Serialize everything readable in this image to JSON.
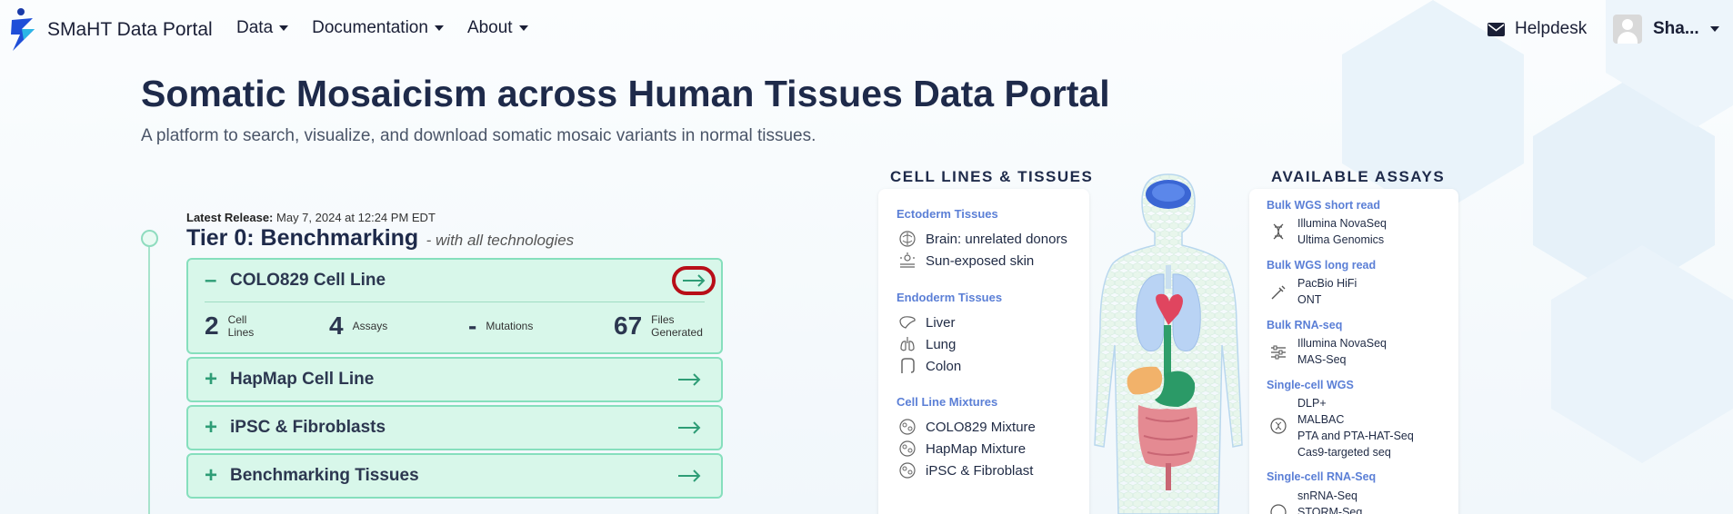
{
  "nav": {
    "brand": "SMaHT Data Portal",
    "menu": [
      {
        "label": "Data"
      },
      {
        "label": "Documentation"
      },
      {
        "label": "About"
      }
    ],
    "helpdesk": "Helpdesk",
    "user": "Sha..."
  },
  "hero": {
    "title": "Somatic Mosaicism across Human Tissues Data Portal",
    "subtitle": "A platform to search, visualize, and download somatic mosaic variants in normal tissues."
  },
  "release": {
    "label": "Latest Release:",
    "date": "May 7, 2024 at 12:24 PM EDT"
  },
  "tier": {
    "title": "Tier 0: Benchmarking",
    "subtitle": "- with all technologies"
  },
  "cards": [
    {
      "title": "COLO829 Cell Line",
      "sign": "–",
      "expanded": true,
      "stats": [
        {
          "num": "2",
          "label": "Cell Lines"
        },
        {
          "num": "4",
          "label": "Assays"
        },
        {
          "num": "-",
          "label": "Mutations"
        },
        {
          "num": "67",
          "label": "Files Generated"
        }
      ]
    },
    {
      "title": "HapMap Cell Line",
      "sign": "+"
    },
    {
      "title": "iPSC & Fibroblasts",
      "sign": "+"
    },
    {
      "title": "Benchmarking Tissues",
      "sign": "+"
    }
  ],
  "cell_lines_tissues": {
    "title": "CELL LINES & TISSUES",
    "groups": [
      {
        "title": "Ectoderm Tissues",
        "items": [
          {
            "label": "Brain: unrelated donors",
            "icon": "brain-icon"
          },
          {
            "label": "Sun-exposed skin",
            "icon": "skin-icon"
          }
        ]
      },
      {
        "title": "Endoderm Tissues",
        "items": [
          {
            "label": "Liver",
            "icon": "liver-icon"
          },
          {
            "label": "Lung",
            "icon": "lung-icon"
          },
          {
            "label": "Colon",
            "icon": "colon-icon"
          }
        ]
      },
      {
        "title": "Cell Line Mixtures",
        "items": [
          {
            "label": "COLO829 Mixture",
            "icon": "cell-mixture-icon"
          },
          {
            "label": "HapMap Mixture",
            "icon": "cell-mixture-icon"
          },
          {
            "label": "iPSC & Fibroblast",
            "icon": "cell-mixture-icon"
          }
        ]
      }
    ]
  },
  "assays": {
    "title": "AVAILABLE ASSAYS",
    "groups": [
      {
        "title": "Bulk WGS short read",
        "icon": "dna-icon",
        "items": [
          "Illumina NovaSeq",
          "Ultima Genomics"
        ]
      },
      {
        "title": "Bulk WGS long read",
        "icon": "pipette-icon",
        "items": [
          "PacBio HiFi",
          "ONT"
        ]
      },
      {
        "title": "Bulk RNA-seq",
        "icon": "sliders-icon",
        "items": [
          "Illumina NovaSeq",
          "MAS-Seq"
        ]
      },
      {
        "title": "Single-cell WGS",
        "icon": "single-cell-icon",
        "items": [
          "DLP+",
          "MALBAC",
          "PTA and PTA-HAT-Seq",
          "Cas9-targeted seq"
        ]
      },
      {
        "title": "Single-cell RNA-Seq",
        "icon": "single-cell-rna-icon",
        "items": [
          "snRNA-Seq",
          "STORM-Seq"
        ]
      }
    ]
  },
  "colors": {
    "accent_green": "#86dfbd",
    "card_bg": "#d8f7ea",
    "group_blue": "#5b7fd6",
    "highlight_red": "#b80e18"
  }
}
